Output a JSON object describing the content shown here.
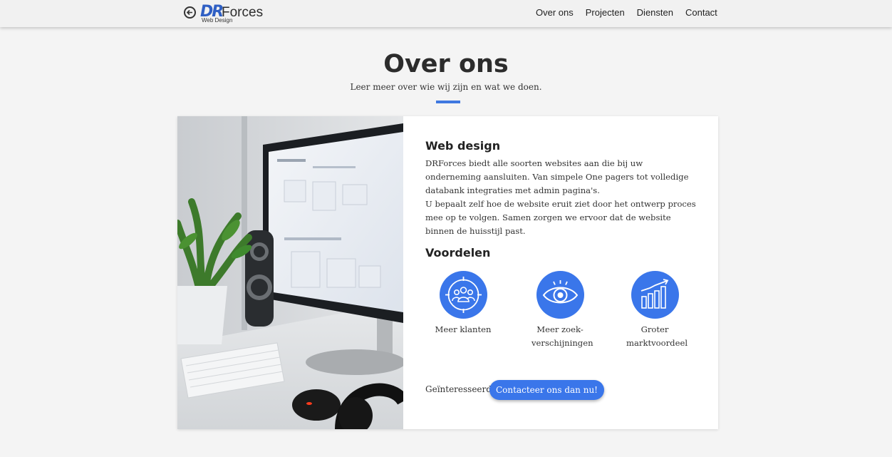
{
  "nav": {
    "logo_main": "DR",
    "logo_forces": "Forces",
    "logo_sub": "Web Design",
    "links": [
      {
        "label": "Over ons",
        "icon": null
      },
      {
        "label": "Projecten",
        "icon": null
      },
      {
        "label": "Diensten",
        "icon": null
      },
      {
        "label": "Contact",
        "icon": null
      }
    ]
  },
  "header": {
    "title": "Over ons",
    "subtitle": "Leer meer over wie wij zijn en wat we doen."
  },
  "web": {
    "heading": "Web design",
    "paragraph1": "DRForces biedt alle soorten websites aan die bij uw onderneming aansluiten. Van simpele One pagers tot volledige databank integraties met admin pagina's.",
    "paragraph2": "U bepaalt zelf hoe de website eruit ziet door het ontwerp proces mee op te volgen. Samen zorgen we ervoor dat de website binnen de huisstijl past."
  },
  "voordelen": {
    "heading": "Voordelen",
    "items": [
      {
        "label": "Meer klanten",
        "icon": "people-target-icon"
      },
      {
        "label": "Meer zoek-verschijningen",
        "icon": "eye-icon"
      },
      {
        "label": "Groter marktvoordeel",
        "icon": "growth-chart-icon"
      }
    ]
  },
  "cta": {
    "question": "Geïnteresseerd?",
    "button": "Contacteer ons dan nu!"
  },
  "colors": {
    "accent": "#3a76ea",
    "logo_blue": "#2f5fc4",
    "text": "#333333"
  }
}
